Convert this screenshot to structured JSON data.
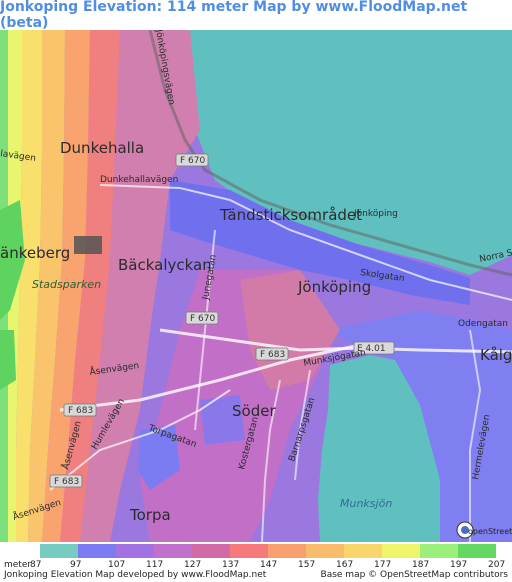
{
  "title": "Jonkoping Elevation: 114 meter Map by www.FloodMap.net (beta)",
  "map": {
    "places": {
      "dunkehalla": "Dunkehalla",
      "tandsticksomradet": "Tändsticksområdet",
      "jonkoping_small": "Jönköping",
      "jonkoping": "Jönköping",
      "backalyckan": "Bäckalyckan",
      "ankeberg": "änkeberg",
      "soder": "Söder",
      "torpa": "Torpa",
      "kalg": "Kålg"
    },
    "parks": {
      "stadsparken": "Stadsparken"
    },
    "water": {
      "munksjon": "Munksjön"
    },
    "roads": {
      "dunkehallavagen": "Dunkehallavägen",
      "lavagen": "lavägen",
      "junegatan": "Junegatan",
      "asenvagen_1": "Åsenvägen",
      "asenvagen_2": "Åsenvägen",
      "asenvagen_3": "Åsenvägen",
      "humlevagen": "Humlevägen",
      "torpagatan": "Torpagatan",
      "kostergatan": "Kostergatan",
      "barnarpsgatan": "Barnarpsgatan",
      "munksjogatan": "Munksjögatan",
      "skolgatan": "Skolgatan",
      "odengatan": "Odengatan",
      "norra": "Norra S",
      "hermelevagen": "Hermelevägen",
      "jonkopingsvagen": "Jönköpingsvägen"
    },
    "shields": [
      "F 670",
      "F 670",
      "F 683",
      "F 683",
      "F 683",
      "E 4.01"
    ],
    "osm_logo": "openStreetMap"
  },
  "legend": {
    "unit_label": "meter",
    "ticks": [
      "87",
      "97",
      "107",
      "117",
      "127",
      "137",
      "147",
      "157",
      "167",
      "177",
      "187",
      "197",
      "207"
    ],
    "colors": [
      "#77ccc2",
      "#7b7bf2",
      "#a272e2",
      "#c071cc",
      "#d26aa8",
      "#f77a7a",
      "#f99e6e",
      "#f9bb6c",
      "#f9d66c",
      "#f0f56e",
      "#9af07a",
      "#63d963"
    ]
  },
  "footer": {
    "left": "Jonkoping Elevation Map developed by www.FloodMap.net",
    "right": "Base map © OpenStreetMap contributors"
  }
}
